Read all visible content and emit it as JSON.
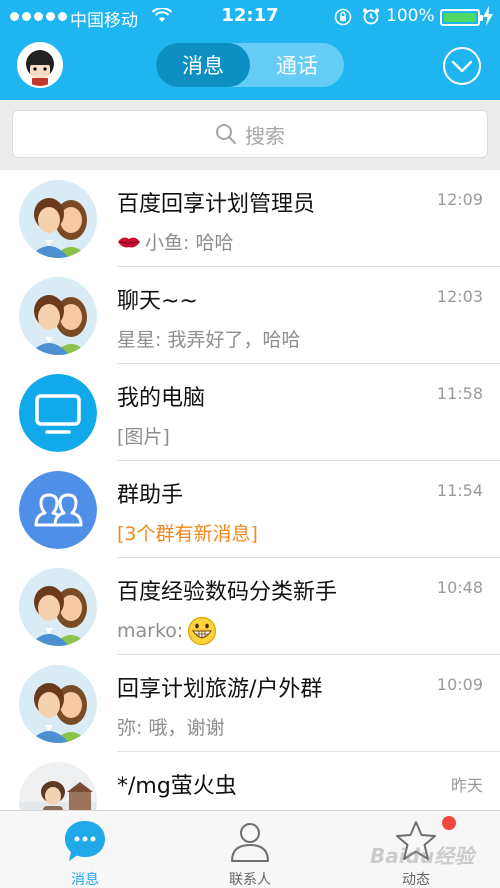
{
  "status_bar": {
    "carrier": "中国移动",
    "time": "12:17",
    "battery": "100%"
  },
  "header": {
    "tabs": [
      "消息",
      "通话"
    ],
    "active_tab": 0
  },
  "search": {
    "placeholder": "搜索"
  },
  "conversations": [
    {
      "name": "百度回享计划管理员",
      "message": "小鱼: 哈哈",
      "time": "12:09",
      "avatar": "couple-avatar",
      "prefix_icon": "lips-icon"
    },
    {
      "name": "聊天~~",
      "message": "星星: 我弄好了，哈哈",
      "time": "12:03",
      "avatar": "couple-avatar"
    },
    {
      "name": "我的电脑",
      "message": "[图片]",
      "time": "11:58",
      "avatar": "computer-avatar"
    },
    {
      "name": "群助手",
      "message": "[3个群有新消息]",
      "time": "11:54",
      "avatar": "group-helper-avatar",
      "message_color": "#f08a1c"
    },
    {
      "name": "百度经验数码分类新手",
      "message": "marko:",
      "time": "10:48",
      "avatar": "couple-avatar",
      "suffix_icon": "grin-emoji-icon"
    },
    {
      "name": "回享计划旅游/户外群",
      "message": "弥: 哦，谢谢",
      "time": "10:09",
      "avatar": "couple-avatar"
    },
    {
      "name": "*/mg萤火虫",
      "message": "",
      "time": "昨天",
      "avatar": "photo-avatar"
    }
  ],
  "tabbar": {
    "items": [
      {
        "label": "消息",
        "icon": "chat-bubble-icon"
      },
      {
        "label": "联系人",
        "icon": "contacts-icon"
      },
      {
        "label": "动态",
        "icon": "star-icon"
      }
    ]
  },
  "watermark": "Baidu经验",
  "colors": {
    "header": "#1fb5f0",
    "active_tab": "#1fa9e8",
    "orange_text": "#f08a1c",
    "badge": "#f0483e"
  }
}
